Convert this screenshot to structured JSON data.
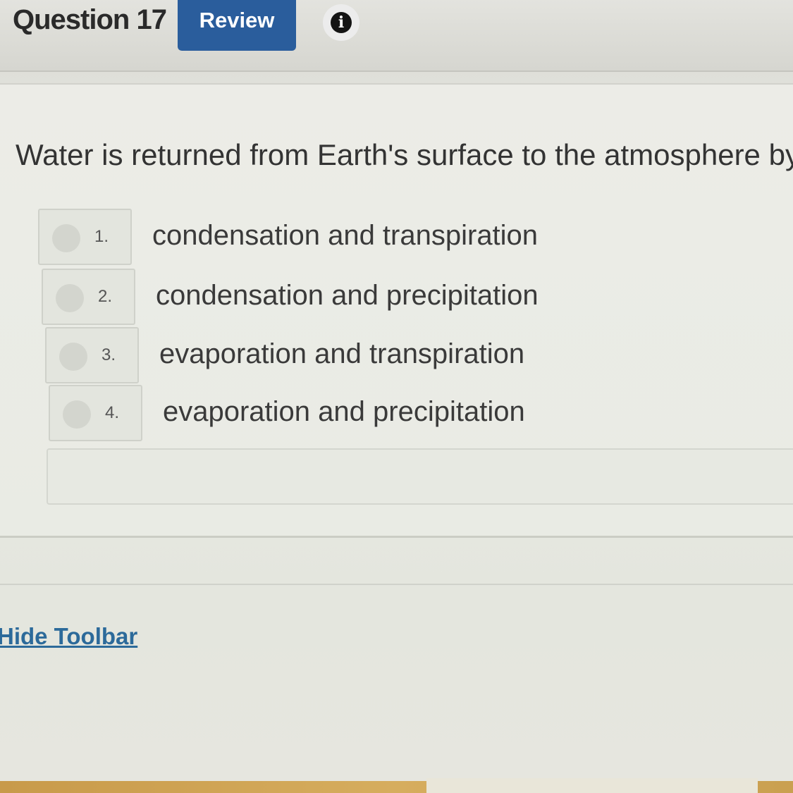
{
  "header": {
    "question_label": "Question 17",
    "review_label": "Review",
    "info_glyph": "i"
  },
  "question": {
    "text": "Water is returned from Earth's surface to the atmosphere by"
  },
  "answers": [
    {
      "number": "1.",
      "text": "condensation and transpiration"
    },
    {
      "number": "2.",
      "text": "condensation and precipitation"
    },
    {
      "number": "3.",
      "text": "evaporation and transpiration"
    },
    {
      "number": "4.",
      "text": "evaporation and precipitation"
    }
  ],
  "toolbar": {
    "hide_label": "Hide Toolbar"
  },
  "icons": {
    "info": "info-icon"
  },
  "colors": {
    "review_button": "#2a5d9c",
    "link": "#2c6a9a"
  }
}
